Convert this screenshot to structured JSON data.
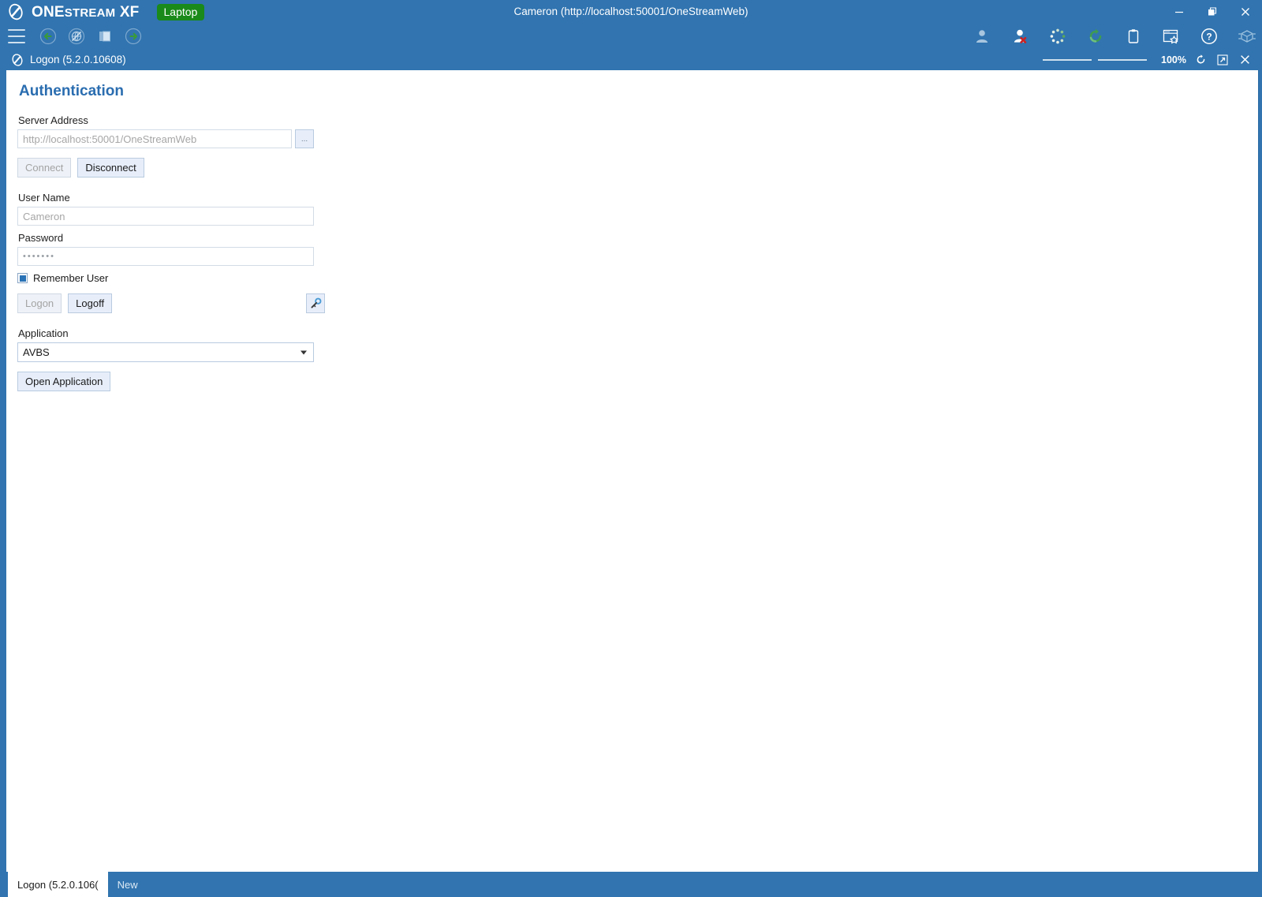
{
  "app": {
    "brand_one": "ONE",
    "brand_stream": "STREAM",
    "brand_xf": "XF",
    "env_badge": "Laptop",
    "window_title": "Cameron (http://localhost:50001/OneStreamWeb)",
    "logo_icon": "onestream-logo-icon"
  },
  "window_controls": {
    "minimize": "minimize-icon",
    "restore": "restore-icon",
    "close": "close-icon"
  },
  "toolbar": {
    "menu": "hamburger-menu-icon",
    "back": "back-arrow-icon",
    "disconnected": "globe-disconnected-icon",
    "copy": "copy-pages-icon",
    "forward": "forward-arrow-icon",
    "user": "user-icon",
    "user_logoff": "user-logoff-icon",
    "busy": "busy-spinner-icon",
    "refresh": "refresh-icon",
    "clipboard": "clipboard-icon",
    "bookmark": "bookmark-window-icon",
    "help": "help-icon",
    "cube": "cube-package-icon"
  },
  "child_window": {
    "title": "Logon (5.2.0.10608)",
    "icon": "onestream-logo-icon",
    "zoom_percent": "100%",
    "refresh": "refresh-icon",
    "popout": "popout-icon",
    "close": "close-icon"
  },
  "form": {
    "heading": "Authentication",
    "server_address_label": "Server Address",
    "server_address_value": "http://localhost:50001/OneStreamWeb",
    "browse_label": "...",
    "connect_label": "Connect",
    "disconnect_label": "Disconnect",
    "user_name_label": "User Name",
    "user_name_value": "Cameron",
    "password_label": "Password",
    "password_value": "•••••••",
    "remember_user_label": "Remember User",
    "logon_label": "Logon",
    "logoff_label": "Logoff",
    "key_icon": "key-icon",
    "application_label": "Application",
    "application_value": "AVBS",
    "open_application_label": "Open Application"
  },
  "taskbar": {
    "tabs": [
      {
        "label": "Logon (5.2.0.106(",
        "active": true
      },
      {
        "label": "New",
        "active": false
      }
    ]
  },
  "colors": {
    "chrome_blue": "#3174b0",
    "accent_heading": "#2a6db0",
    "badge_green": "#1a8a1a",
    "button_face": "#e7eefa"
  }
}
